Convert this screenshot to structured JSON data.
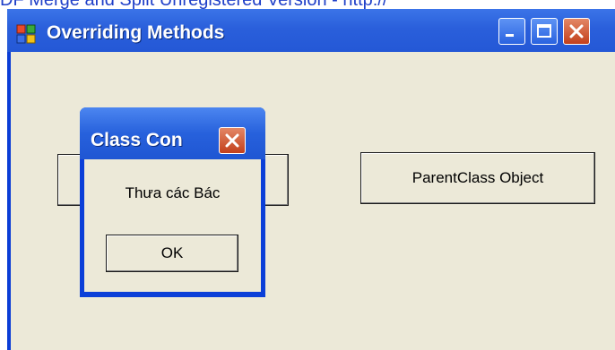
{
  "watermark": "DF Merge and Split Unregistered Version - http://",
  "window": {
    "title": "Overriding Methods",
    "icons": {
      "app": "app-form-icon",
      "minimize": "minimize-icon",
      "maximize": "maximize-icon",
      "close": "close-icon"
    }
  },
  "form": {
    "left_button_label": "",
    "parent_button_label": "ParentClass Object"
  },
  "dialog": {
    "title": "Class Con",
    "message": "Thưa các Bác",
    "ok_label": "OK"
  },
  "colors": {
    "titlebar": "#2a5fdb",
    "window_bg": "#ece9d8",
    "close_btn": "#c3401c",
    "watermark": "#1f3fc8"
  }
}
